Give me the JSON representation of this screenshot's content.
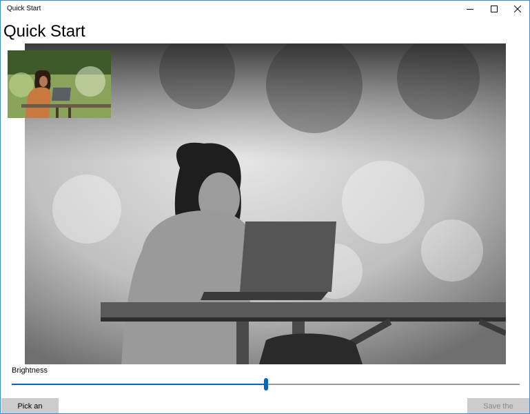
{
  "window": {
    "title": "Quick Start",
    "controls": [
      "minimize-icon",
      "maximize-icon",
      "close-icon"
    ]
  },
  "page": {
    "title": "Quick Start"
  },
  "preview": {
    "main_image_icon": "photo-grayscale",
    "thumbnail_icon": "photo-color"
  },
  "brightness": {
    "label": "Brightness",
    "value_fraction": 0.501
  },
  "actions": {
    "pick_label": "Pick an image",
    "save_label": "Save the image",
    "save_enabled": false
  },
  "colors": {
    "accent": "#0067c0",
    "window_border": "#3b8ad6",
    "button_bg": "#cccccc",
    "disabled_text": "#8a8a8a"
  }
}
